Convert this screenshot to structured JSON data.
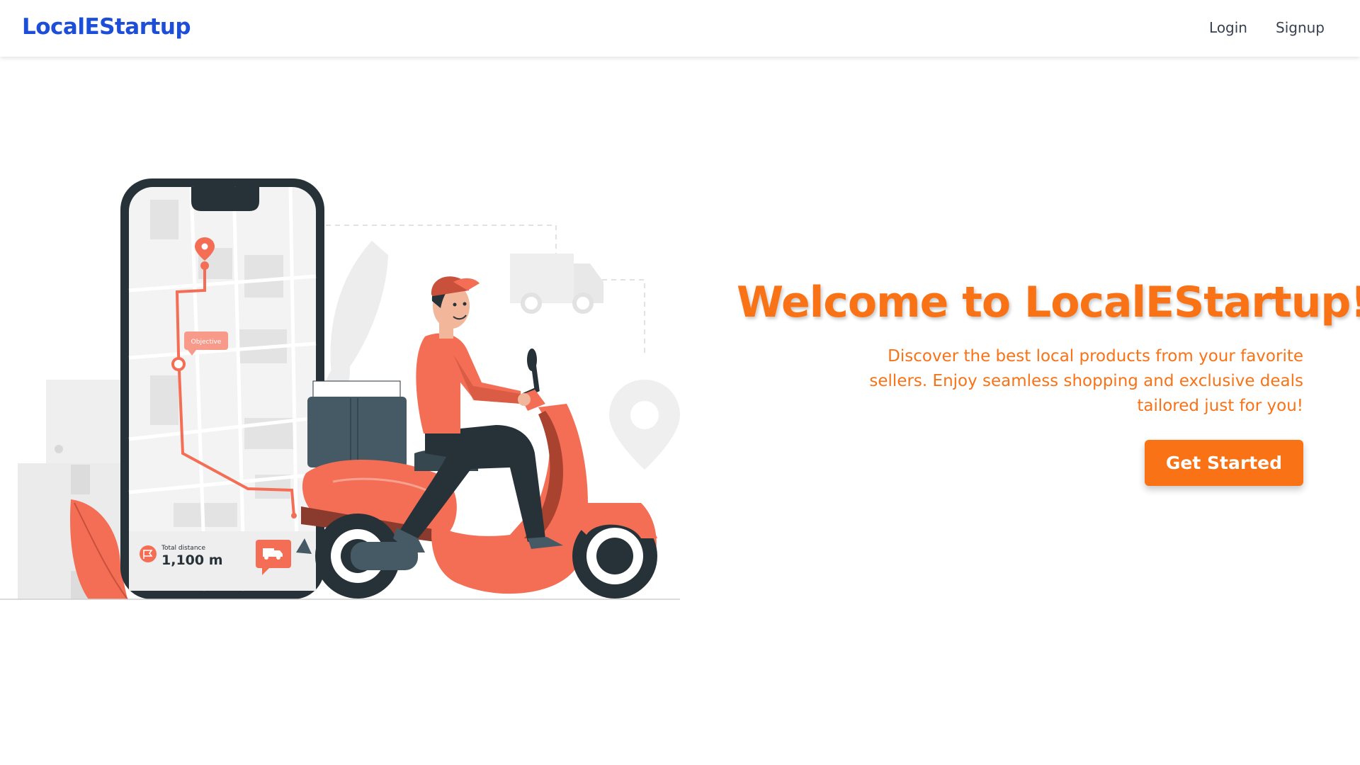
{
  "nav": {
    "brand": "LocalEStartup",
    "links": [
      {
        "label": "Login"
      },
      {
        "label": "Signup"
      }
    ]
  },
  "hero": {
    "title": "Welcome to LocalEStartup!",
    "subtitle": "Discover the best local products from your favorite sellers. Enjoy seamless shopping and exclusive deals tailored just for you!",
    "cta_label": "Get Started"
  },
  "illustration": {
    "map_tag": "Objective",
    "distance_caption": "Total distance",
    "distance_value": "1,100 m",
    "icons": [
      "map-pin-icon",
      "flag-icon",
      "truck-icon",
      "location-pin-icon"
    ]
  },
  "colors": {
    "brand": "#1d4ed8",
    "accent": "#f97316",
    "nav_text": "#374151",
    "illustration_coral": "#f46e56",
    "illustration_dark": "#263238"
  }
}
